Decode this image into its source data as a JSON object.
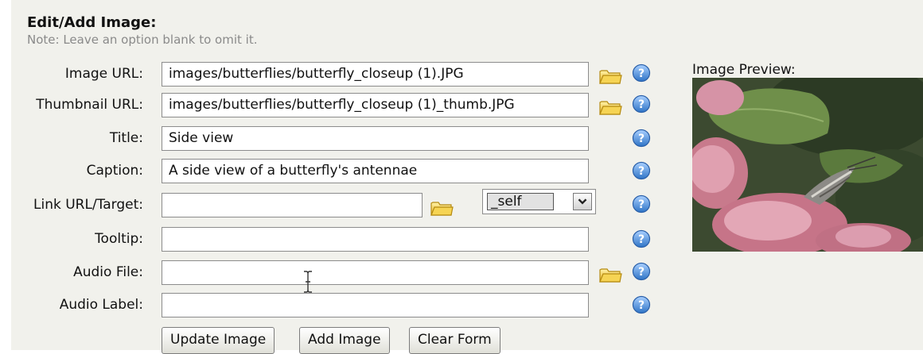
{
  "header": {
    "title": "Edit/Add Image:",
    "note": "Note: Leave an option blank to omit it."
  },
  "fields": {
    "image_url": {
      "label": "Image URL:",
      "value": "images/butterflies/butterfly_closeup (1).JPG"
    },
    "thumbnail_url": {
      "label": "Thumbnail URL:",
      "value": "images/butterflies/butterfly_closeup (1)_thumb.JPG"
    },
    "title": {
      "label": "Title:",
      "value": "Side view"
    },
    "caption": {
      "label": "Caption:",
      "value": "A side view of a butterfly's antennae"
    },
    "link": {
      "label": "Link URL/Target:",
      "value": "",
      "target": "_self"
    },
    "tooltip": {
      "label": "Tooltip:",
      "value": ""
    },
    "audio_file": {
      "label": "Audio File:",
      "value": ""
    },
    "audio_label": {
      "label": "Audio Label:",
      "value": ""
    }
  },
  "buttons": {
    "update": "Update Image",
    "add": "Add Image",
    "clear": "Clear Form"
  },
  "preview": {
    "label": "Image Preview:"
  },
  "icons": {
    "browse": "folder-icon",
    "help": "help-icon"
  },
  "colors": {
    "panel_background": "#f1f1ec",
    "note_text": "#8a8a8a",
    "help_icon": "#4f8fd8",
    "folder_icon": "#f1c531"
  }
}
